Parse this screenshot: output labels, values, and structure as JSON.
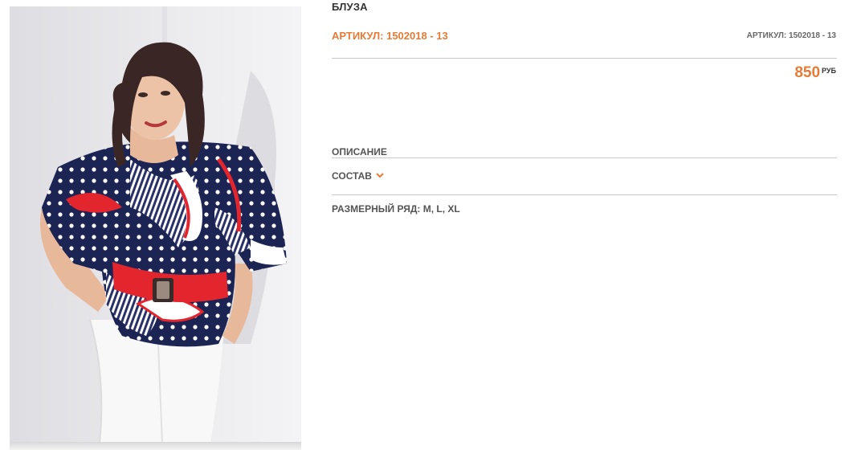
{
  "product": {
    "title": "БЛУЗА",
    "article_main": "АРТИКУЛ: 1502018 - 13",
    "article_small": "АРТИКУЛ: 1502018 - 13",
    "price_value": "850",
    "price_currency": "РУБ"
  },
  "sections": {
    "description_label": "ОПИСАНИЕ",
    "composition_label": "СОСТАВ"
  },
  "sizes": {
    "label": "РАЗМЕРНЫЙ РЯД: M, L, XL"
  },
  "colors": {
    "accent": "#e77b36",
    "text": "#333333",
    "divider": "#c8c8c8"
  },
  "icons": {
    "composition_toggle": "chevron-down-icon"
  }
}
